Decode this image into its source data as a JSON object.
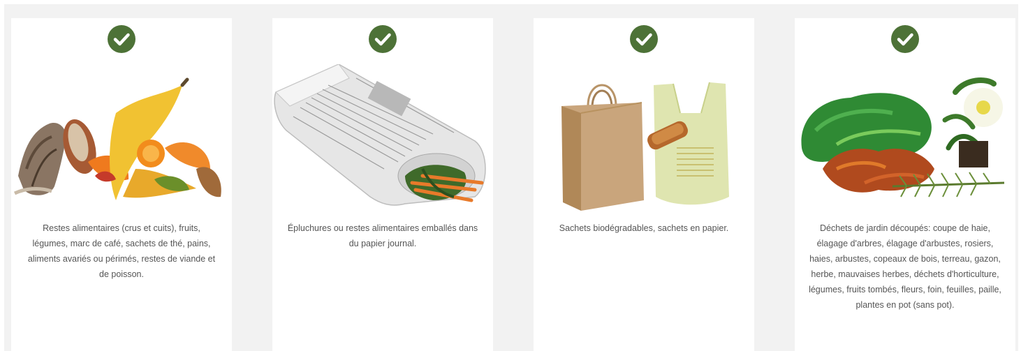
{
  "cards": [
    {
      "icon": "check-circle-icon",
      "image": "food-scraps-illustration",
      "text": "Restes alimentaires (crus et cuits), fruits, légumes, marc de café, sachets de thé, pains, aliments avariés ou périmés, restes de viande et de poisson."
    },
    {
      "icon": "check-circle-icon",
      "image": "newspaper-wrap-illustration",
      "text": "Épluchures ou restes alimentaires emballés dans du papier journal."
    },
    {
      "icon": "check-circle-icon",
      "image": "bags-illustration",
      "text": "Sachets biodégradables, sachets en papier."
    },
    {
      "icon": "check-circle-icon",
      "image": "garden-waste-illustration",
      "text": "Déchets de jardin découpés: coupe de haie, élagage d'arbres, élagage d'arbustes, rosiers, haies, arbustes, copeaux de bois, terreau, gazon, herbe, mauvaises herbes, déchets d'horticulture, légumes, fruits tombés, fleurs, foin, feuilles, paille, plantes en pot (sans pot)."
    }
  ],
  "colors": {
    "check": "#4d7237",
    "panel": "#f2f2f2",
    "card": "#ffffff",
    "text": "#555555"
  }
}
